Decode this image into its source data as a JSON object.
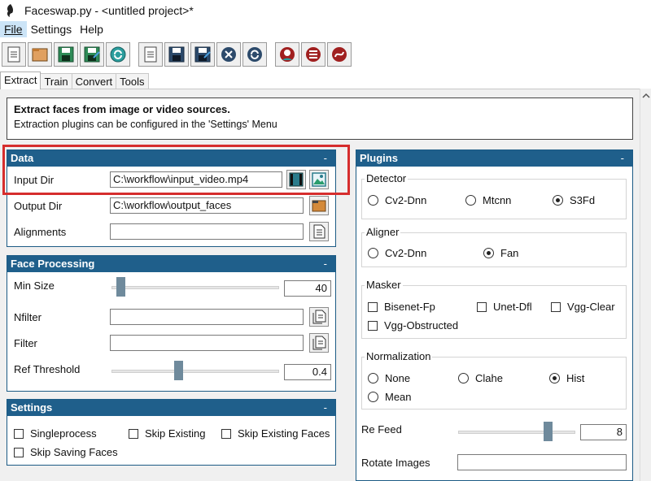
{
  "window": {
    "title": "Faceswap.py - <untitled project>*"
  },
  "menu": {
    "file": "File",
    "settings": "Settings",
    "help": "Help"
  },
  "toolbar": {
    "icons": [
      "new-project-icon",
      "open-project-icon",
      "save-project-icon",
      "save-as-project-icon",
      "reload-project-icon",
      "new-task-icon",
      "save-task-icon",
      "save-as-task-icon",
      "clear-task-icon",
      "reload-task-icon",
      "extract-settings-icon",
      "train-settings-icon",
      "convert-settings-icon"
    ]
  },
  "tabs": [
    "Extract",
    "Train",
    "Convert",
    "Tools"
  ],
  "info": {
    "title": "Extract faces from image or video sources.",
    "subtitle": "Extraction plugins can be configured in the 'Settings' Menu"
  },
  "data_panel": {
    "header": "Data",
    "minimize": "-",
    "input_dir_label": "Input Dir",
    "input_dir_value": "C:\\workflow\\input_video.mp4",
    "output_dir_label": "Output Dir",
    "output_dir_value": "C:\\workflow\\output_faces",
    "alignments_label": "Alignments",
    "alignments_value": ""
  },
  "face_panel": {
    "header": "Face Processing",
    "minimize": "-",
    "min_size_label": "Min Size",
    "min_size_value": "40",
    "min_size_level": 0.04,
    "nfilter_label": "Nfilter",
    "filter_label": "Filter",
    "ref_threshold_label": "Ref Threshold",
    "ref_threshold_value": "0.4",
    "ref_threshold_level": 0.4
  },
  "settings_panel": {
    "header": "Settings",
    "minimize": "-",
    "singleprocess": "Singleprocess",
    "skip_existing": "Skip Existing",
    "skip_existing_faces": "Skip Existing Faces",
    "skip_saving_faces": "Skip Saving Faces"
  },
  "plugins_panel": {
    "header": "Plugins",
    "minimize": "-",
    "detector": {
      "label": "Detector",
      "options": [
        "Cv2-Dnn",
        "Mtcnn",
        "S3Fd"
      ],
      "selected": "S3Fd"
    },
    "aligner": {
      "label": "Aligner",
      "options": [
        "Cv2-Dnn",
        "Fan"
      ],
      "selected": "Fan"
    },
    "masker": {
      "label": "Masker",
      "options": [
        "Bisenet-Fp",
        "Unet-Dfl",
        "Vgg-Clear",
        "Vgg-Obstructed"
      ]
    },
    "normalization": {
      "label": "Normalization",
      "options": [
        "None",
        "Clahe",
        "Hist",
        "Mean"
      ],
      "selected": "Hist"
    },
    "re_feed_label": "Re Feed",
    "re_feed_value": "8",
    "re_feed_level": 0.8,
    "rotate_images_label": "Rotate Images",
    "rotate_images_value": ""
  },
  "colors": {
    "panel_header": "#1f5f8b",
    "highlight": "#d62d2d",
    "slider_thumb": "#6f8a9c"
  }
}
